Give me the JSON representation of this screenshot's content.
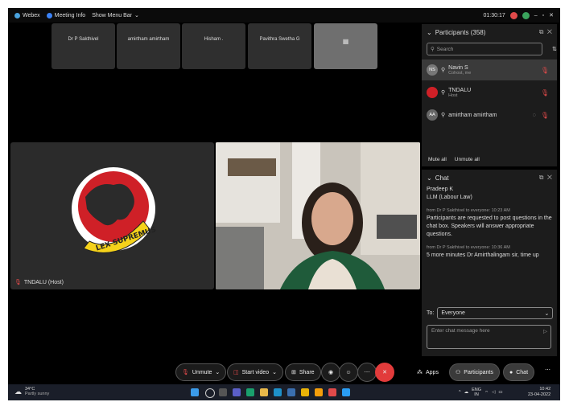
{
  "topbar": {
    "app_name": "Webex",
    "meeting_info": "Meeting Info",
    "show_menu_bar": "Show Menu Bar",
    "timer": "01:30:17"
  },
  "tiles": [
    {
      "name": "Dr P Sakthivel"
    },
    {
      "name": "amirtham amirtham"
    },
    {
      "name": "Hisham ."
    },
    {
      "name": "Pavithra Swetha G"
    }
  ],
  "stage": {
    "host_label": "TNDALU (Host)",
    "logo_text": "LEX SUPREMUS"
  },
  "participants": {
    "title": "Participants (358)",
    "search_placeholder": "Search",
    "items": [
      {
        "initials": "NS",
        "name": "Navin S",
        "role": "Cohost, me"
      },
      {
        "initials": "",
        "name": "TNDALU",
        "role": "Host"
      },
      {
        "initials": "AA",
        "name": "amirtham amirtham",
        "role": ""
      }
    ],
    "mute_all": "Mute all",
    "unmute_all": "Unmute all"
  },
  "chat": {
    "title": "Chat",
    "messages": [
      {
        "text": "Pradeep K"
      },
      {
        "text": "LLM (Labour Law)"
      },
      {
        "meta": "from Dr P Sakthivel to everyone:   10:23 AM",
        "text": "Participants are requested to post questions in the chat box. Speakers will answer appropriate questions."
      },
      {
        "meta": "from Dr P Sakthivel to everyone:   10:36 AM",
        "text": "5 more minutes Dr Amirthalingam sir, time up"
      }
    ],
    "to_label": "To:",
    "to_value": "Everyone",
    "input_placeholder": "Enter chat message here"
  },
  "controls": {
    "unmute": "Unmute",
    "start_video": "Start video",
    "share": "Share",
    "apps": "Apps",
    "participants": "Participants",
    "chat": "Chat"
  },
  "taskbar": {
    "weather_temp": "34°C",
    "weather_desc": "Partly sunny",
    "lang": "ENG",
    "lang2": "IN",
    "time": "10:42",
    "date": "23-04-2022"
  },
  "colors": {
    "accent_red": "#e14a4a",
    "panel_bg": "#1c1c1c"
  }
}
